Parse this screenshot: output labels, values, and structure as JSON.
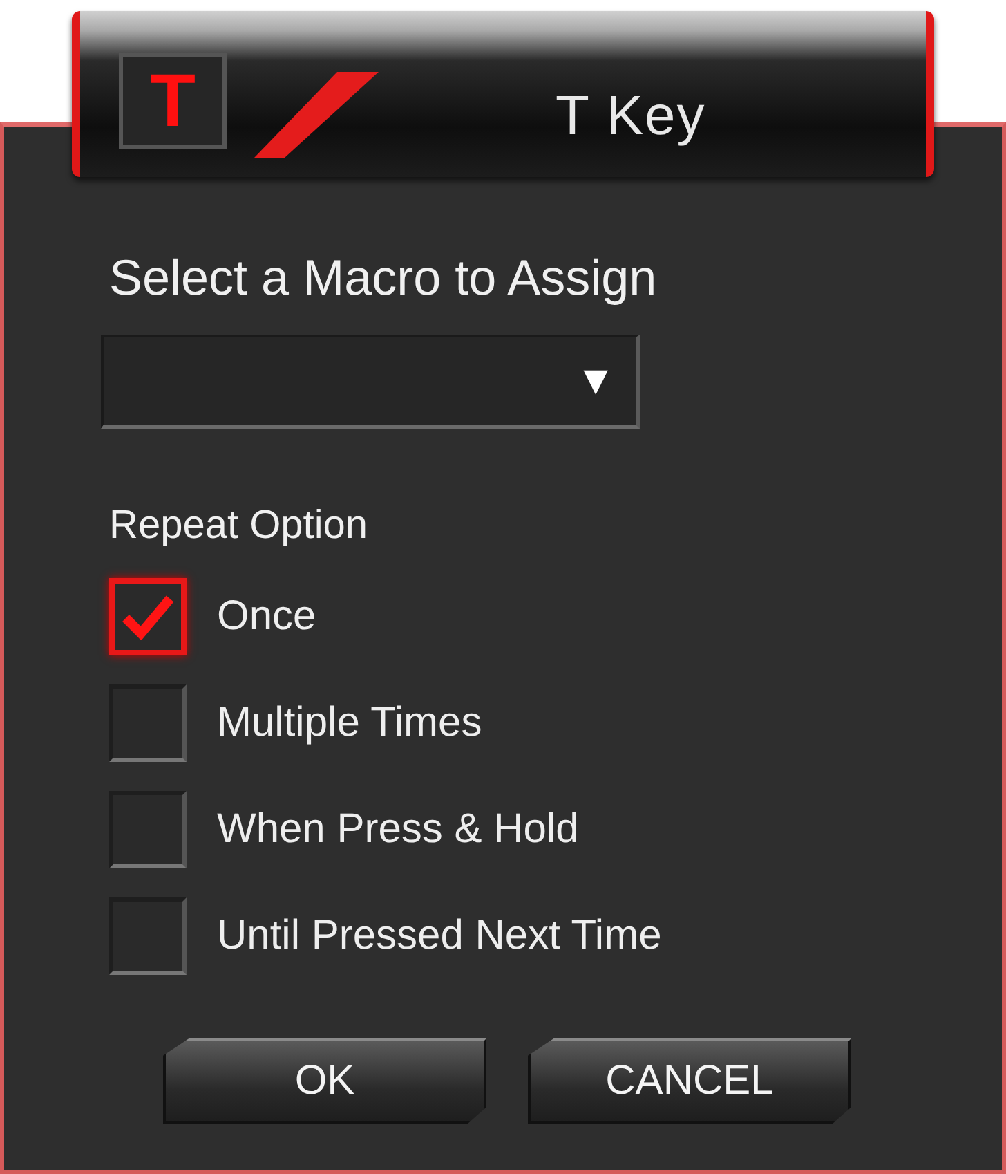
{
  "header": {
    "logo": "T",
    "title": "T Key"
  },
  "macro": {
    "label": "Select a Macro to Assign",
    "dropdown_arrow": "▼"
  },
  "repeat": {
    "label": "Repeat Option",
    "options": [
      {
        "label": "Once",
        "checked": true
      },
      {
        "label": "Multiple Times",
        "checked": false
      },
      {
        "label": "When Press & Hold",
        "checked": false
      },
      {
        "label": "Until Pressed Next Time",
        "checked": false
      }
    ]
  },
  "buttons": [
    "OK",
    "CANCEL"
  ]
}
